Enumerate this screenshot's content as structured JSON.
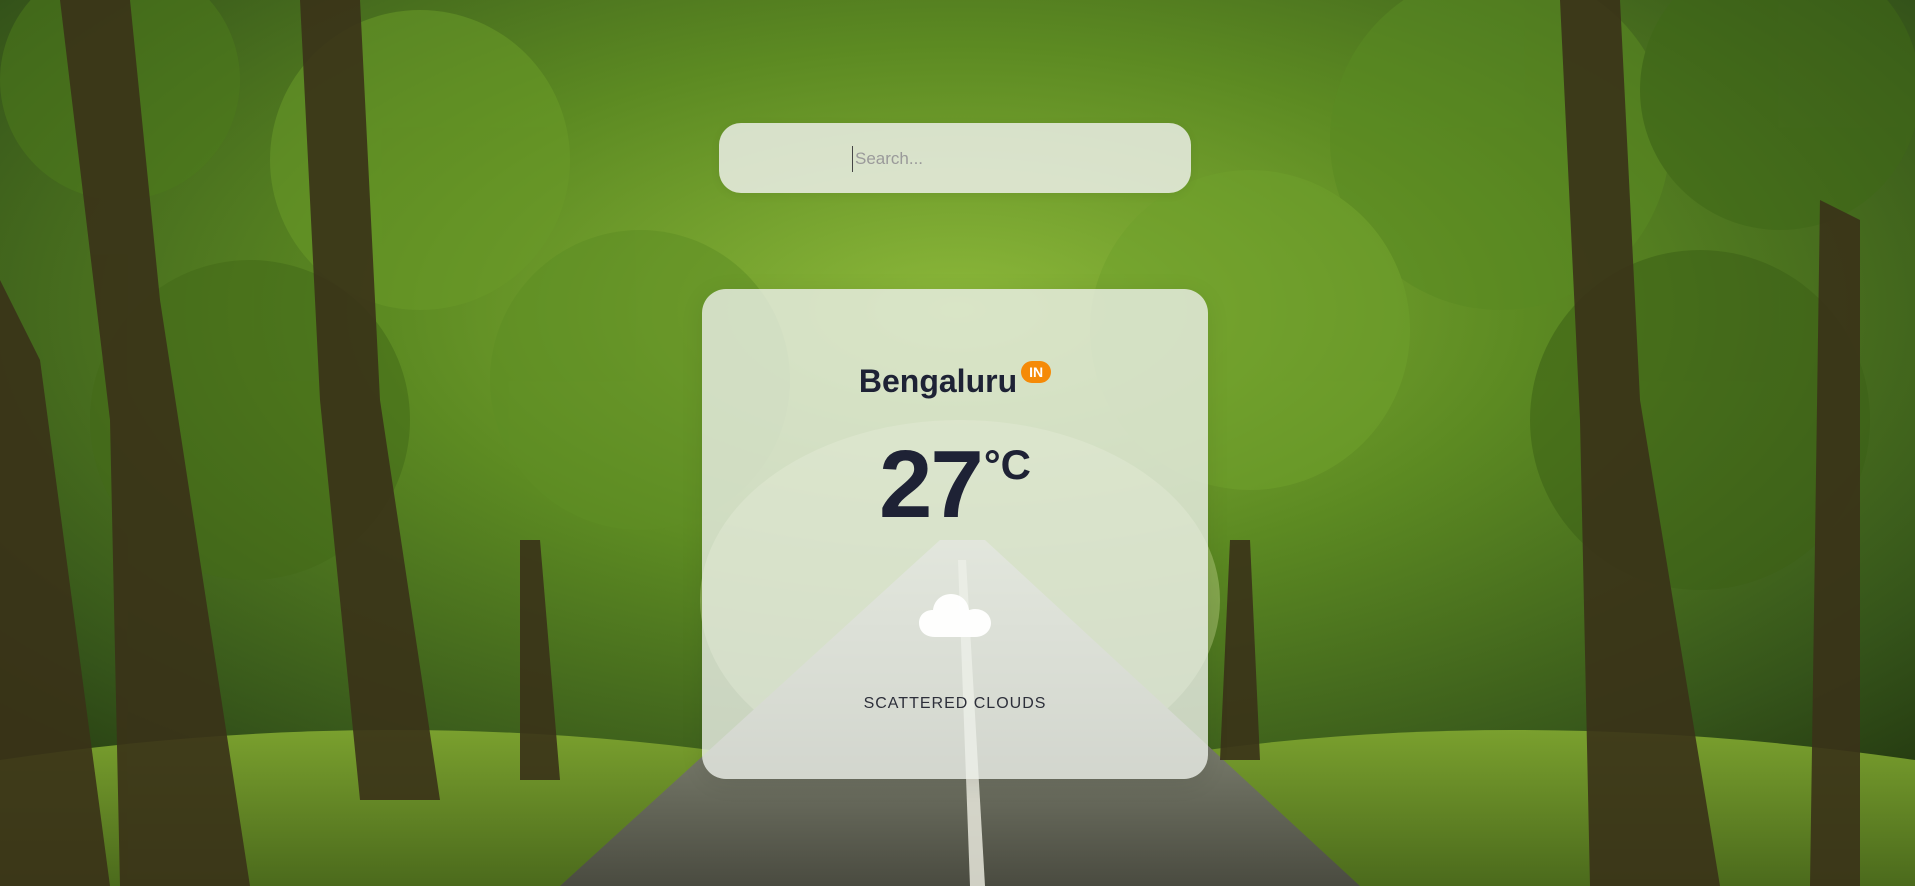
{
  "search": {
    "placeholder": "Search...",
    "value": ""
  },
  "weather": {
    "city": "Bengaluru",
    "country_code": "IN",
    "temperature": "27",
    "unit": "°C",
    "description": "SCATTERED CLOUDS",
    "icon": "cloud-icon"
  },
  "colors": {
    "badge": "#f58a07",
    "text_primary": "#1e2235",
    "card_bg": "rgba(236,240,234,0.80)"
  }
}
